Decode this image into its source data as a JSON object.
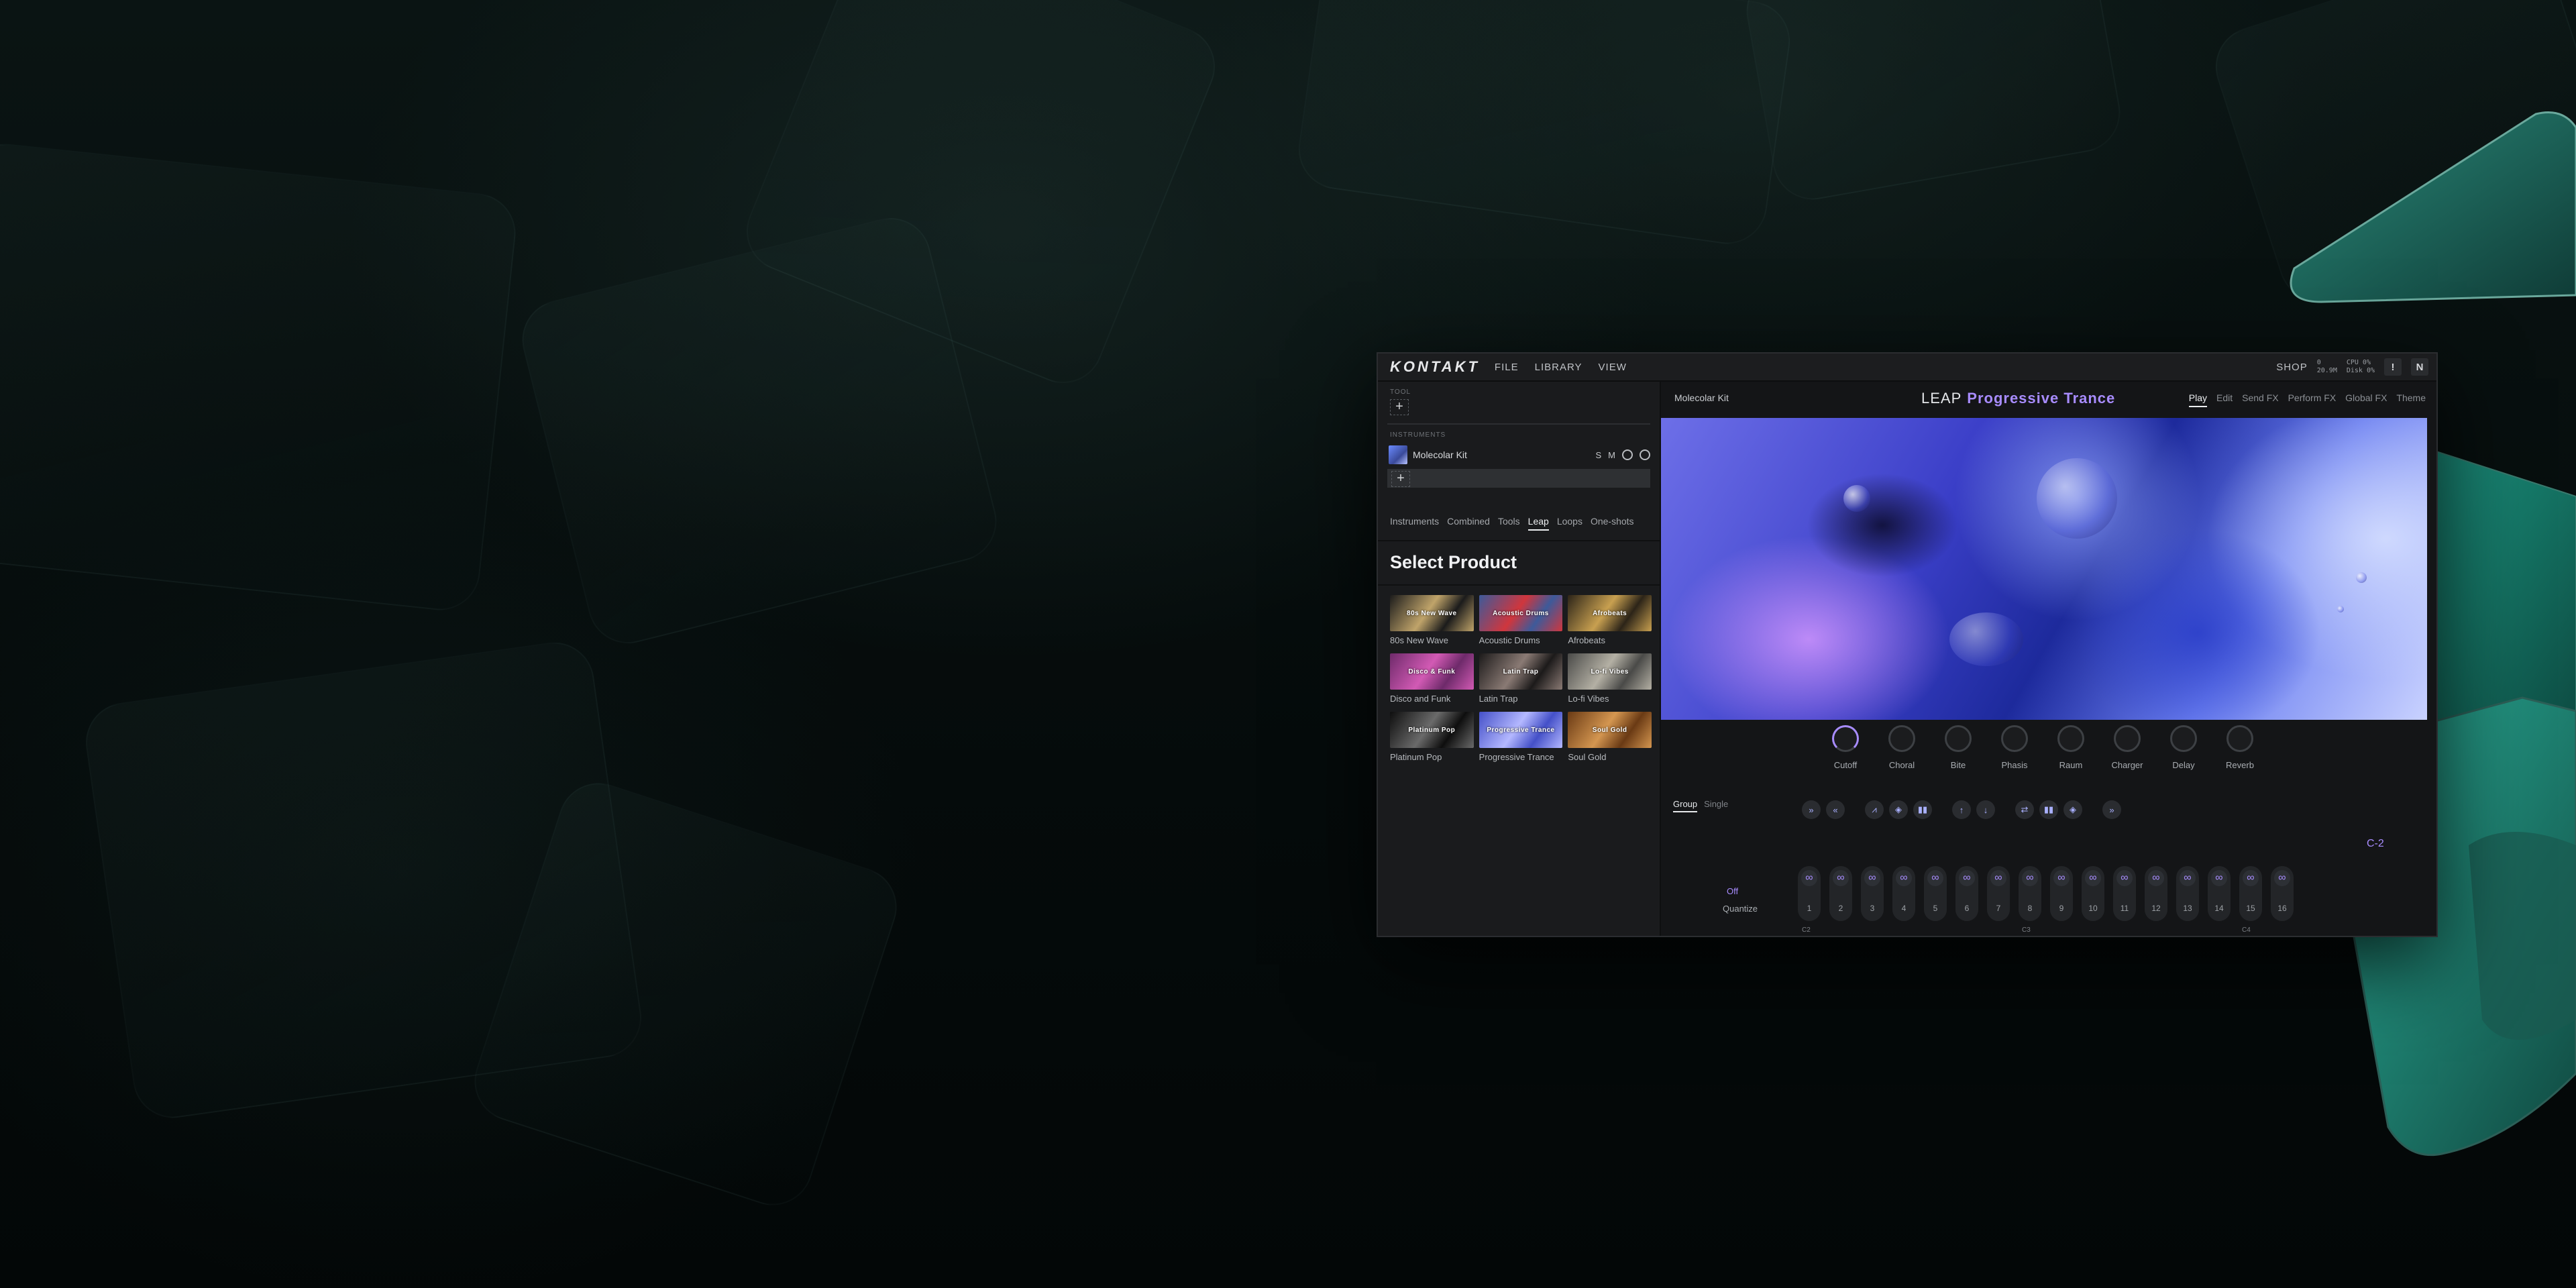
{
  "window": {
    "logo": "KONTAKT",
    "menu": [
      "FILE",
      "LIBRARY",
      "VIEW"
    ],
    "shop": "SHOP",
    "stats": {
      "midi": "0",
      "mem": "20.9M",
      "cpu": "CPU 0%",
      "disk": "Disk 0%"
    },
    "alert_icon": "!",
    "ni_icon": "N"
  },
  "left": {
    "tool_label": "TOOL",
    "instruments_label": "INSTRUMENTS",
    "instrument": {
      "name": "Molecolar Kit",
      "solo": "S",
      "mute": "M"
    },
    "add_symbol": "+",
    "tabs": [
      "Instruments",
      "Combined",
      "Tools",
      "Leap",
      "Loops",
      "One-shots"
    ],
    "active_tab": "Leap",
    "select_title": "Select Product",
    "products": [
      {
        "label": "80s New Wave",
        "thumb_text": "80s New Wave",
        "c1": "#1b1b1b",
        "c2": "#c0a46a"
      },
      {
        "label": "Acoustic Drums",
        "thumb_text": "Acoustic Drums",
        "c1": "#3d5a9a",
        "c2": "#d0363d"
      },
      {
        "label": "Afrobeats",
        "thumb_text": "Afrobeats",
        "c1": "#2c2418",
        "c2": "#c8a050"
      },
      {
        "label": "Disco and Funk",
        "thumb_text": "Disco & Funk",
        "c1": "#6e2a6a",
        "c2": "#d25ab4"
      },
      {
        "label": "Latin Trap",
        "thumb_text": "Latin Trap",
        "c1": "#1c1a1a",
        "c2": "#8a7a74"
      },
      {
        "label": "Lo-fi Vibes",
        "thumb_text": "Lo-fi Vibes",
        "c1": "#4a4a48",
        "c2": "#b4b0a4"
      },
      {
        "label": "Platinum Pop",
        "thumb_text": "Platinum Pop",
        "c1": "#0e0e0e",
        "c2": "#6a6a6a"
      },
      {
        "label": "Progressive Trance",
        "thumb_text": "Progressive Trance",
        "c1": "#4450c8",
        "c2": "#b4b8ff"
      },
      {
        "label": "Soul Gold",
        "thumb_text": "Soul Gold",
        "c1": "#6a3a14",
        "c2": "#d49650"
      }
    ]
  },
  "right": {
    "kit_name": "Molecolar Kit",
    "leap_word": "LEAP",
    "product_name": "Progressive Trance",
    "tabs": [
      "Play",
      "Edit",
      "Send FX",
      "Perform FX",
      "Global FX",
      "Theme"
    ],
    "active_tab": "Play",
    "knobs": [
      "Cutoff",
      "Choral",
      "Bite",
      "Phasis",
      "Raum",
      "Charger",
      "Delay",
      "Reverb"
    ],
    "modes": [
      "Group",
      "Single"
    ],
    "active_mode": "Group",
    "off_label": "Off",
    "quantize_label": "Quantize",
    "steps": [
      "1",
      "2",
      "3",
      "4",
      "5",
      "6",
      "7",
      "8",
      "9",
      "10",
      "11",
      "12",
      "13",
      "14",
      "15",
      "16"
    ],
    "notes": [
      "C2",
      "C3",
      "C4"
    ],
    "key_label": "C-2",
    "accent": "#a88cff"
  }
}
